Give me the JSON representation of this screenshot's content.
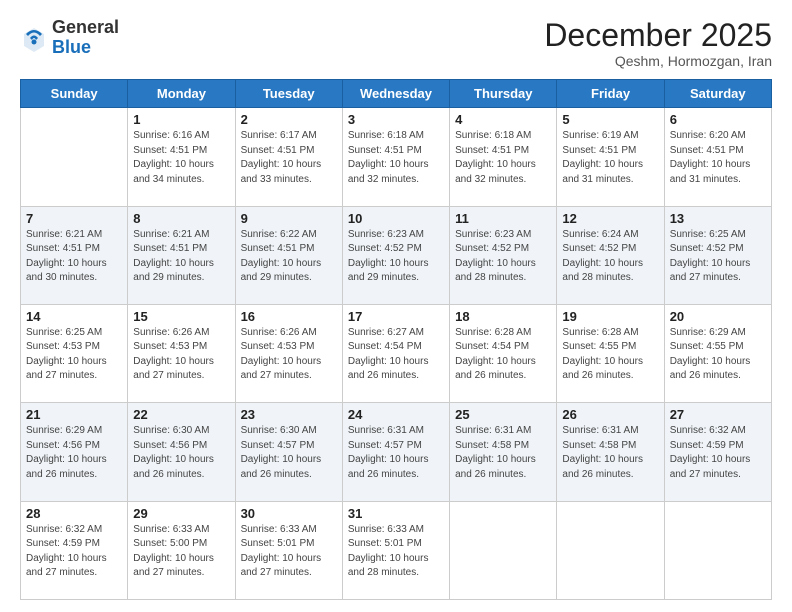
{
  "header": {
    "logo_general": "General",
    "logo_blue": "Blue",
    "month": "December 2025",
    "location": "Qeshm, Hormozgan, Iran"
  },
  "days_of_week": [
    "Sunday",
    "Monday",
    "Tuesday",
    "Wednesday",
    "Thursday",
    "Friday",
    "Saturday"
  ],
  "weeks": [
    [
      {
        "day": "",
        "info": ""
      },
      {
        "day": "1",
        "info": "Sunrise: 6:16 AM\nSunset: 4:51 PM\nDaylight: 10 hours\nand 34 minutes."
      },
      {
        "day": "2",
        "info": "Sunrise: 6:17 AM\nSunset: 4:51 PM\nDaylight: 10 hours\nand 33 minutes."
      },
      {
        "day": "3",
        "info": "Sunrise: 6:18 AM\nSunset: 4:51 PM\nDaylight: 10 hours\nand 32 minutes."
      },
      {
        "day": "4",
        "info": "Sunrise: 6:18 AM\nSunset: 4:51 PM\nDaylight: 10 hours\nand 32 minutes."
      },
      {
        "day": "5",
        "info": "Sunrise: 6:19 AM\nSunset: 4:51 PM\nDaylight: 10 hours\nand 31 minutes."
      },
      {
        "day": "6",
        "info": "Sunrise: 6:20 AM\nSunset: 4:51 PM\nDaylight: 10 hours\nand 31 minutes."
      }
    ],
    [
      {
        "day": "7",
        "info": "Sunrise: 6:21 AM\nSunset: 4:51 PM\nDaylight: 10 hours\nand 30 minutes."
      },
      {
        "day": "8",
        "info": "Sunrise: 6:21 AM\nSunset: 4:51 PM\nDaylight: 10 hours\nand 29 minutes."
      },
      {
        "day": "9",
        "info": "Sunrise: 6:22 AM\nSunset: 4:51 PM\nDaylight: 10 hours\nand 29 minutes."
      },
      {
        "day": "10",
        "info": "Sunrise: 6:23 AM\nSunset: 4:52 PM\nDaylight: 10 hours\nand 29 minutes."
      },
      {
        "day": "11",
        "info": "Sunrise: 6:23 AM\nSunset: 4:52 PM\nDaylight: 10 hours\nand 28 minutes."
      },
      {
        "day": "12",
        "info": "Sunrise: 6:24 AM\nSunset: 4:52 PM\nDaylight: 10 hours\nand 28 minutes."
      },
      {
        "day": "13",
        "info": "Sunrise: 6:25 AM\nSunset: 4:52 PM\nDaylight: 10 hours\nand 27 minutes."
      }
    ],
    [
      {
        "day": "14",
        "info": "Sunrise: 6:25 AM\nSunset: 4:53 PM\nDaylight: 10 hours\nand 27 minutes."
      },
      {
        "day": "15",
        "info": "Sunrise: 6:26 AM\nSunset: 4:53 PM\nDaylight: 10 hours\nand 27 minutes."
      },
      {
        "day": "16",
        "info": "Sunrise: 6:26 AM\nSunset: 4:53 PM\nDaylight: 10 hours\nand 27 minutes."
      },
      {
        "day": "17",
        "info": "Sunrise: 6:27 AM\nSunset: 4:54 PM\nDaylight: 10 hours\nand 26 minutes."
      },
      {
        "day": "18",
        "info": "Sunrise: 6:28 AM\nSunset: 4:54 PM\nDaylight: 10 hours\nand 26 minutes."
      },
      {
        "day": "19",
        "info": "Sunrise: 6:28 AM\nSunset: 4:55 PM\nDaylight: 10 hours\nand 26 minutes."
      },
      {
        "day": "20",
        "info": "Sunrise: 6:29 AM\nSunset: 4:55 PM\nDaylight: 10 hours\nand 26 minutes."
      }
    ],
    [
      {
        "day": "21",
        "info": "Sunrise: 6:29 AM\nSunset: 4:56 PM\nDaylight: 10 hours\nand 26 minutes."
      },
      {
        "day": "22",
        "info": "Sunrise: 6:30 AM\nSunset: 4:56 PM\nDaylight: 10 hours\nand 26 minutes."
      },
      {
        "day": "23",
        "info": "Sunrise: 6:30 AM\nSunset: 4:57 PM\nDaylight: 10 hours\nand 26 minutes."
      },
      {
        "day": "24",
        "info": "Sunrise: 6:31 AM\nSunset: 4:57 PM\nDaylight: 10 hours\nand 26 minutes."
      },
      {
        "day": "25",
        "info": "Sunrise: 6:31 AM\nSunset: 4:58 PM\nDaylight: 10 hours\nand 26 minutes."
      },
      {
        "day": "26",
        "info": "Sunrise: 6:31 AM\nSunset: 4:58 PM\nDaylight: 10 hours\nand 26 minutes."
      },
      {
        "day": "27",
        "info": "Sunrise: 6:32 AM\nSunset: 4:59 PM\nDaylight: 10 hours\nand 27 minutes."
      }
    ],
    [
      {
        "day": "28",
        "info": "Sunrise: 6:32 AM\nSunset: 4:59 PM\nDaylight: 10 hours\nand 27 minutes."
      },
      {
        "day": "29",
        "info": "Sunrise: 6:33 AM\nSunset: 5:00 PM\nDaylight: 10 hours\nand 27 minutes."
      },
      {
        "day": "30",
        "info": "Sunrise: 6:33 AM\nSunset: 5:01 PM\nDaylight: 10 hours\nand 27 minutes."
      },
      {
        "day": "31",
        "info": "Sunrise: 6:33 AM\nSunset: 5:01 PM\nDaylight: 10 hours\nand 28 minutes."
      },
      {
        "day": "",
        "info": ""
      },
      {
        "day": "",
        "info": ""
      },
      {
        "day": "",
        "info": ""
      }
    ]
  ]
}
